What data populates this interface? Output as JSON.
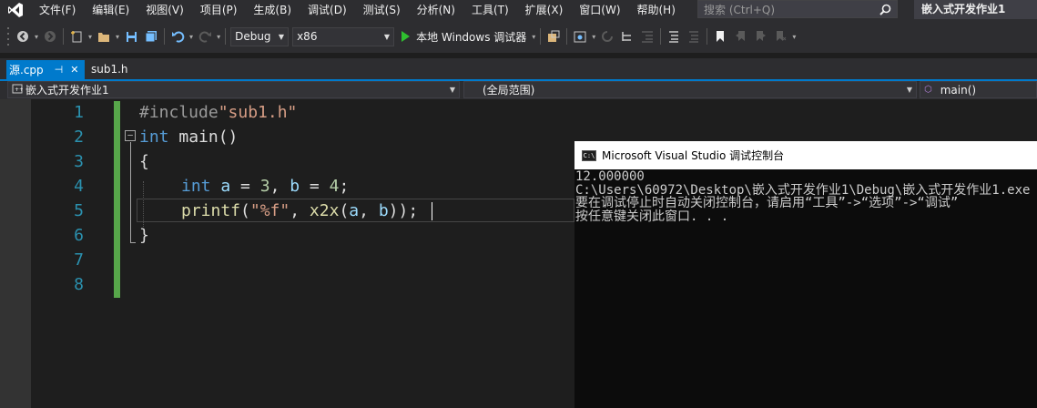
{
  "menubar": {
    "items": [
      "文件(F)",
      "编辑(E)",
      "视图(V)",
      "项目(P)",
      "生成(B)",
      "调试(D)",
      "测试(S)",
      "分析(N)",
      "工具(T)",
      "扩展(X)",
      "窗口(W)",
      "帮助(H)"
    ],
    "search_placeholder": "搜索 (Ctrl+Q)",
    "project_title": "嵌入式开发作业1"
  },
  "toolbar": {
    "config": "Debug",
    "platform": "x86",
    "run_label": "本地 Windows 调试器"
  },
  "tabs": {
    "active": "源.cpp",
    "inactive": "sub1.h"
  },
  "navbar": {
    "project": "嵌入式开发作业1",
    "scope": "(全局范围)",
    "member": "main()"
  },
  "editor": {
    "line_numbers": [
      "1",
      "2",
      "3",
      "4",
      "5",
      "6",
      "7",
      "8"
    ],
    "code": {
      "l1_directive": "#include",
      "l1_file": "\"sub1.h\"",
      "l2_type": "int",
      "l2_name": " main()",
      "l3": "{",
      "l4_type": "int",
      "l4_a": "a",
      "l4_eq1": " = ",
      "l4_v1": "3",
      "l4_mid": ", ",
      "l4_b": "b",
      "l4_eq2": " = ",
      "l4_v2": "4",
      "l4_end": ";",
      "l5_fn": "printf",
      "l5_open": "(",
      "l5_str": "\"%f\"",
      "l5_comma": ", ",
      "l5_fn2": "x2x",
      "l5_open2": "(",
      "l5_a": "a",
      "l5_comma2": ", ",
      "l5_b": "b",
      "l5_close": "));",
      "l6": "}"
    }
  },
  "console": {
    "title": "Microsoft Visual Studio 调试控制台",
    "lines": [
      "12.000000",
      "C:\\Users\\60972\\Desktop\\嵌入式开发作业1\\Debug\\嵌入式开发作业1.exe",
      "要在调试停止时自动关闭控制台，请启用“工具”->“选项”->“调试”",
      "按任意键关闭此窗口. . ."
    ]
  },
  "colors": {
    "accent": "#007acc",
    "keyword": "#569cd6",
    "string": "#d69d85",
    "function": "#dcdcaa",
    "variable": "#9cdcfe",
    "number": "#b5cea8",
    "line_number": "#2b91af",
    "change_bar": "#57a64a"
  }
}
